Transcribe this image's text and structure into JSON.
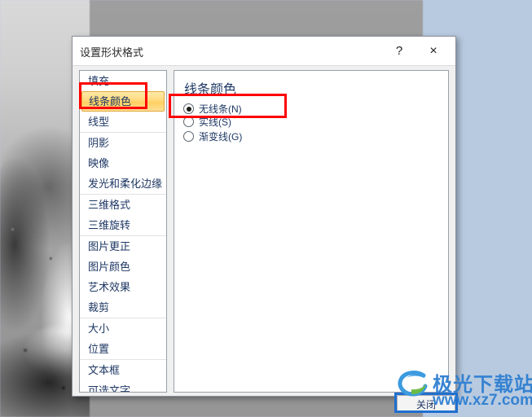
{
  "dialog": {
    "title": "设置形状格式",
    "help_button": "?",
    "close_button": "×",
    "footer_close_label": "关闭"
  },
  "sidebar": {
    "groups": [
      {
        "items": [
          {
            "label": "填充",
            "selected": false
          },
          {
            "label": "线条颜色",
            "selected": true
          },
          {
            "label": "线型",
            "selected": false
          }
        ]
      },
      {
        "items": [
          {
            "label": "阴影",
            "selected": false
          },
          {
            "label": "映像",
            "selected": false
          },
          {
            "label": "发光和柔化边缘",
            "selected": false
          }
        ]
      },
      {
        "items": [
          {
            "label": "三维格式",
            "selected": false
          },
          {
            "label": "三维旋转",
            "selected": false
          }
        ]
      },
      {
        "items": [
          {
            "label": "图片更正",
            "selected": false
          },
          {
            "label": "图片颜色",
            "selected": false
          },
          {
            "label": "艺术效果",
            "selected": false
          },
          {
            "label": "裁剪",
            "selected": false
          }
        ]
      },
      {
        "items": [
          {
            "label": "大小",
            "selected": false
          },
          {
            "label": "位置",
            "selected": false
          }
        ]
      },
      {
        "items": [
          {
            "label": "文本框",
            "selected": false
          },
          {
            "label": "可选文字",
            "selected": false
          }
        ]
      }
    ]
  },
  "panel": {
    "heading": "线条颜色",
    "radios": [
      {
        "label": "无线条(N)",
        "checked": true
      },
      {
        "label": "实线(S)",
        "checked": false
      },
      {
        "label": "渐变线(G)",
        "checked": false
      }
    ]
  },
  "annotations": [
    {
      "name": "sidebar-line-color-highlight",
      "color": "#ff0000"
    },
    {
      "name": "line-color-options-highlight",
      "color": "#ff0000"
    },
    {
      "name": "close-button-highlight",
      "color": "#1f6fd0"
    }
  ],
  "watermark": {
    "title": "极光下载站",
    "url": "www.xz7.com",
    "color": "#2f7fd1"
  },
  "colors": {
    "desktop_background": "#b8cae0",
    "dialog_background": "#f0f0f0",
    "selected_item_fill": "#ffd97a",
    "text_blue": "#1f3864"
  }
}
